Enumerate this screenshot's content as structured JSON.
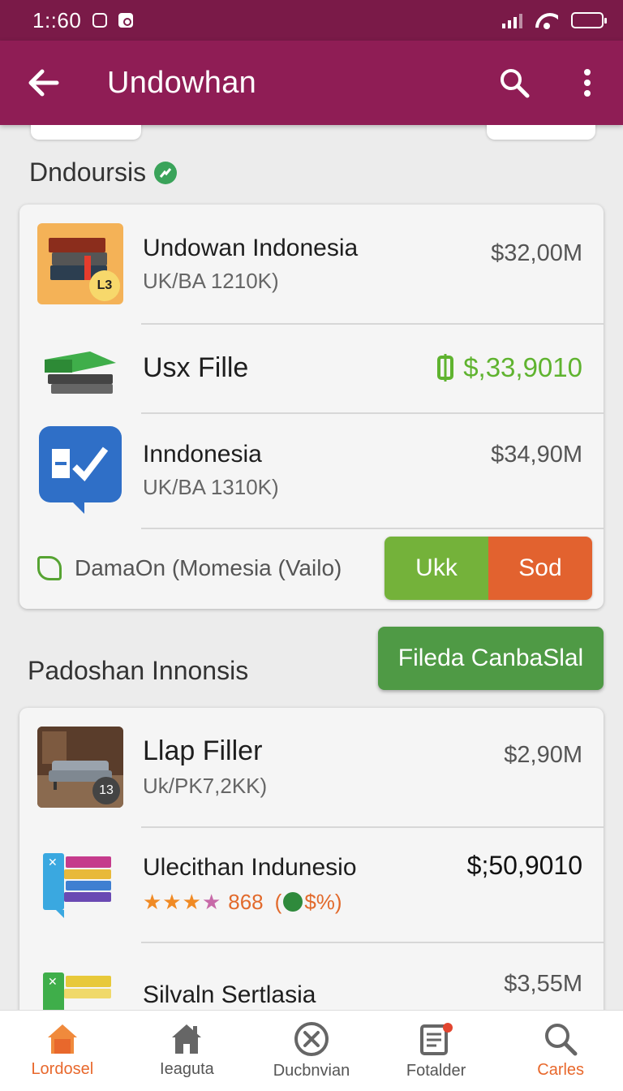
{
  "status_bar": {
    "time": "1::60"
  },
  "app_bar": {
    "title": "Undowhan"
  },
  "section1": {
    "title": "Dndoursis",
    "items": [
      {
        "title": "Undowan Indonesia",
        "subtitle": "UK/BA 1210K)",
        "price": "$32,00M",
        "thumb_badge": "L3"
      },
      {
        "title": "Usx Fille",
        "subtitle": "",
        "price": "$,33,9010"
      },
      {
        "title": "Inndonesia",
        "subtitle": "UK/BA 1310K)",
        "price": "$34,90M"
      }
    ],
    "footer": {
      "text": "DamaOn (Momesia (Vailo)",
      "btn_left": "Ukk",
      "btn_right": "Sod"
    }
  },
  "cta": {
    "label": "Fileda CanbaSlal"
  },
  "section2": {
    "title": "Padoshan Innonsis",
    "items": [
      {
        "title": "Llap Filler",
        "subtitle": "Uk/PK7,2KK)",
        "price": "$2,90M",
        "thumb_badge": "13"
      },
      {
        "title": "Ulecithan Indunesio",
        "rating": "868",
        "rating_extra": "$%)",
        "price": "$;50,9010"
      },
      {
        "title": "Silvaln Sertlasia",
        "subtitle": "",
        "price": "$3,55M"
      }
    ]
  },
  "bottom_nav": [
    {
      "label": "Lordosel",
      "icon": "home-icon",
      "active": true
    },
    {
      "label": "Ieaguta",
      "icon": "house-icon",
      "active": false
    },
    {
      "label": "Ducbnvian",
      "icon": "close-circle-icon",
      "active": false
    },
    {
      "label": "Fotalder",
      "icon": "notes-icon",
      "active": false
    },
    {
      "label": "Carles",
      "icon": "search-icon",
      "active": true
    }
  ],
  "colors": {
    "status_bar": "#7a1a48",
    "app_bar": "#8f1d55",
    "accent_green": "#5fb32f",
    "accent_orange": "#e2622f"
  }
}
